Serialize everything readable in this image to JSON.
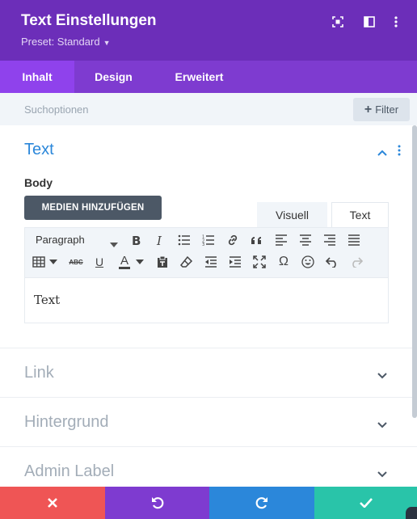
{
  "header": {
    "title": "Text Einstellungen",
    "preset": "Preset: Standard",
    "bg_color": "#6c2eb9",
    "icons": [
      "target-icon",
      "sidebar-toggle-icon",
      "more-vertical-icon"
    ]
  },
  "tabs": [
    {
      "label": "Inhalt",
      "active": true
    },
    {
      "label": "Design",
      "active": false
    },
    {
      "label": "Erweitert",
      "active": false
    }
  ],
  "search": {
    "placeholder": "Suchoptionen",
    "filter_label": "Filter"
  },
  "text_section": {
    "title": "Text",
    "body_label": "Body",
    "media_button": "MEDIEN HINZUFÜGEN",
    "editor_tabs": [
      "Visuell",
      "Text"
    ],
    "paragraph_select": "Paragraph",
    "toolbar_row1": [
      "bold-icon",
      "italic-icon",
      "bullet-list-icon",
      "numbered-list-icon",
      "link-icon",
      "blockquote-icon",
      "align-left-icon",
      "align-center-icon",
      "align-right-icon",
      "align-justify-icon"
    ],
    "toolbar_row2": [
      "table-icon",
      "strikethrough-icon",
      "underline-icon",
      "text-color-icon",
      "paste-as-text-icon",
      "clear-formatting-icon",
      "outdent-icon",
      "indent-icon",
      "fullscreen-icon",
      "special-character-icon",
      "emoji-icon",
      "undo-icon",
      "redo-icon"
    ],
    "strike_text": "ABC",
    "omega": "Ω",
    "underline_letter": "U",
    "color_letter": "A",
    "content": "Text"
  },
  "sections": [
    {
      "title": "Link"
    },
    {
      "title": "Hintergrund"
    },
    {
      "title": "Admin Label"
    }
  ],
  "footer": {
    "buttons": [
      {
        "name": "cancel",
        "color": "#ef5555"
      },
      {
        "name": "undo",
        "color": "#7e3bd0"
      },
      {
        "name": "redo",
        "color": "#2b87da"
      },
      {
        "name": "save",
        "color": "#29c4a9"
      }
    ]
  },
  "colors": {
    "accent": "#2b87da",
    "muted": "#a3adb8",
    "tab_bar": "#7e3bd0",
    "tab_active": "#8f42ec"
  }
}
